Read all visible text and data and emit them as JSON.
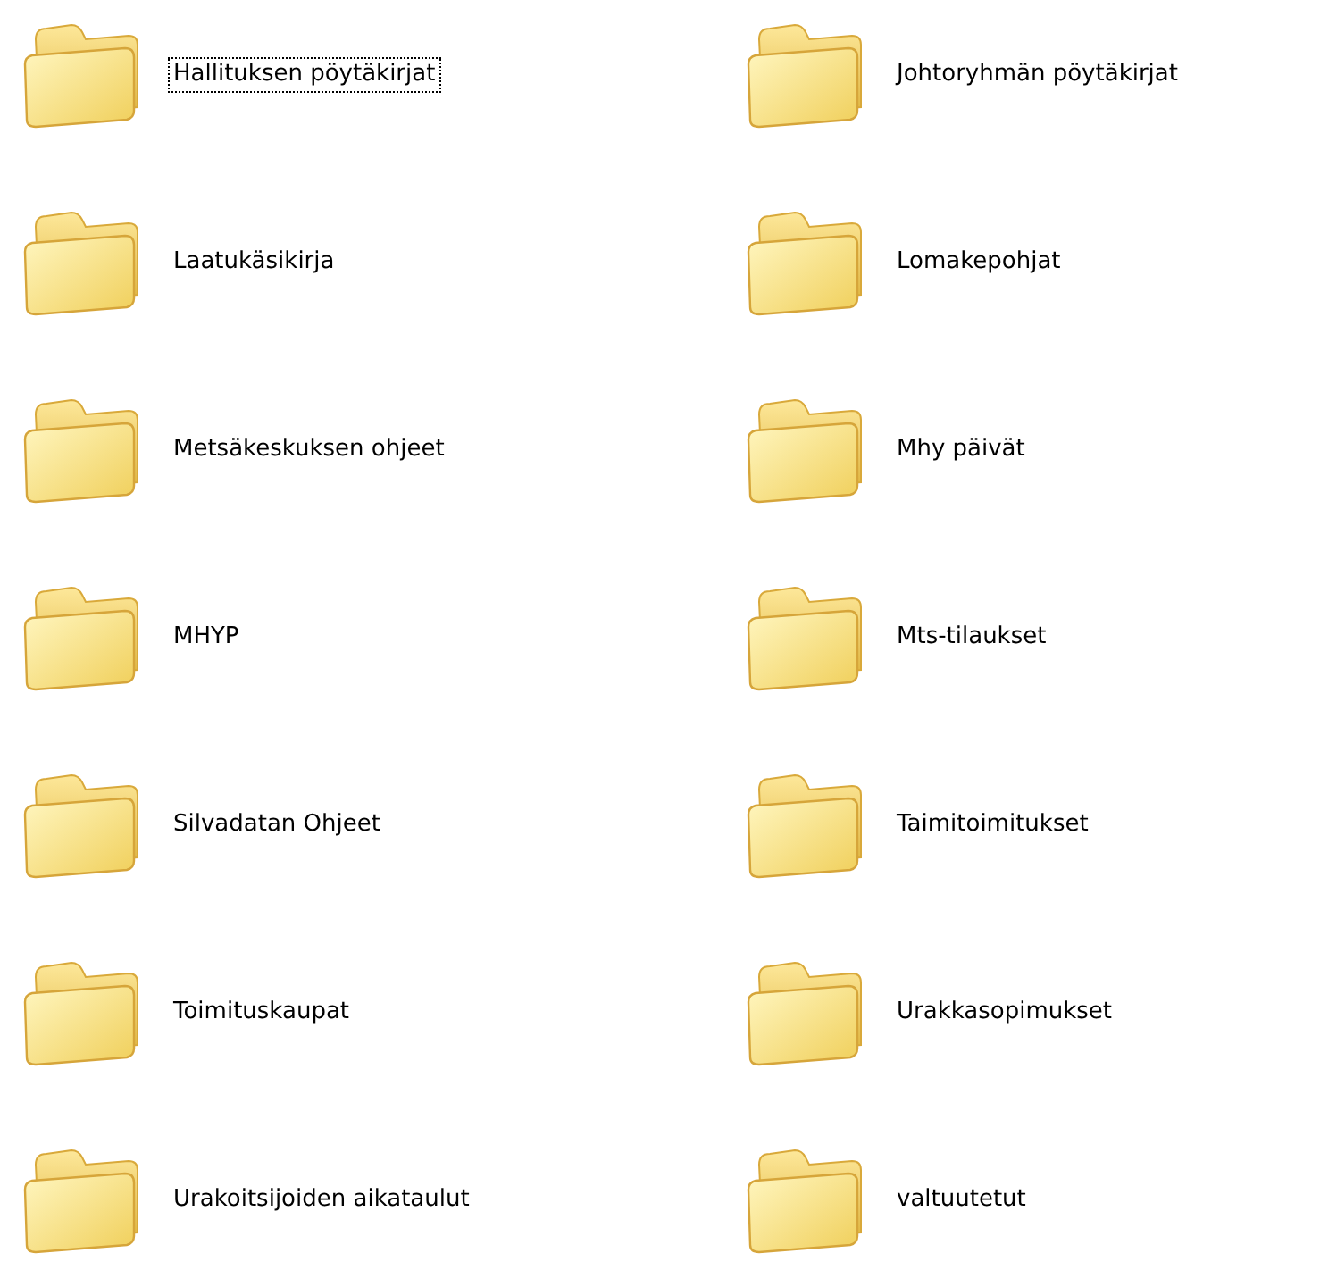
{
  "folders": [
    {
      "label": "Hallituksen pöytäkirjat",
      "focused": true
    },
    {
      "label": "Johtoryhmän pöytäkirjat",
      "focused": false
    },
    {
      "label": "Laatukäsikirja",
      "focused": false
    },
    {
      "label": "Lomakepohjat",
      "focused": false
    },
    {
      "label": "Metsäkeskuksen ohjeet",
      "focused": false
    },
    {
      "label": "Mhy päivät",
      "focused": false
    },
    {
      "label": "MHYP",
      "focused": false
    },
    {
      "label": "Mts-tilaukset",
      "focused": false
    },
    {
      "label": "Silvadatan Ohjeet",
      "focused": false
    },
    {
      "label": "Taimitoimitukset",
      "focused": false
    },
    {
      "label": "Toimituskaupat",
      "focused": false
    },
    {
      "label": "Urakkasopimukset",
      "focused": false
    },
    {
      "label": "Urakoitsijoiden aikataulut",
      "focused": false
    },
    {
      "label": "valtuutetut",
      "focused": false
    }
  ]
}
